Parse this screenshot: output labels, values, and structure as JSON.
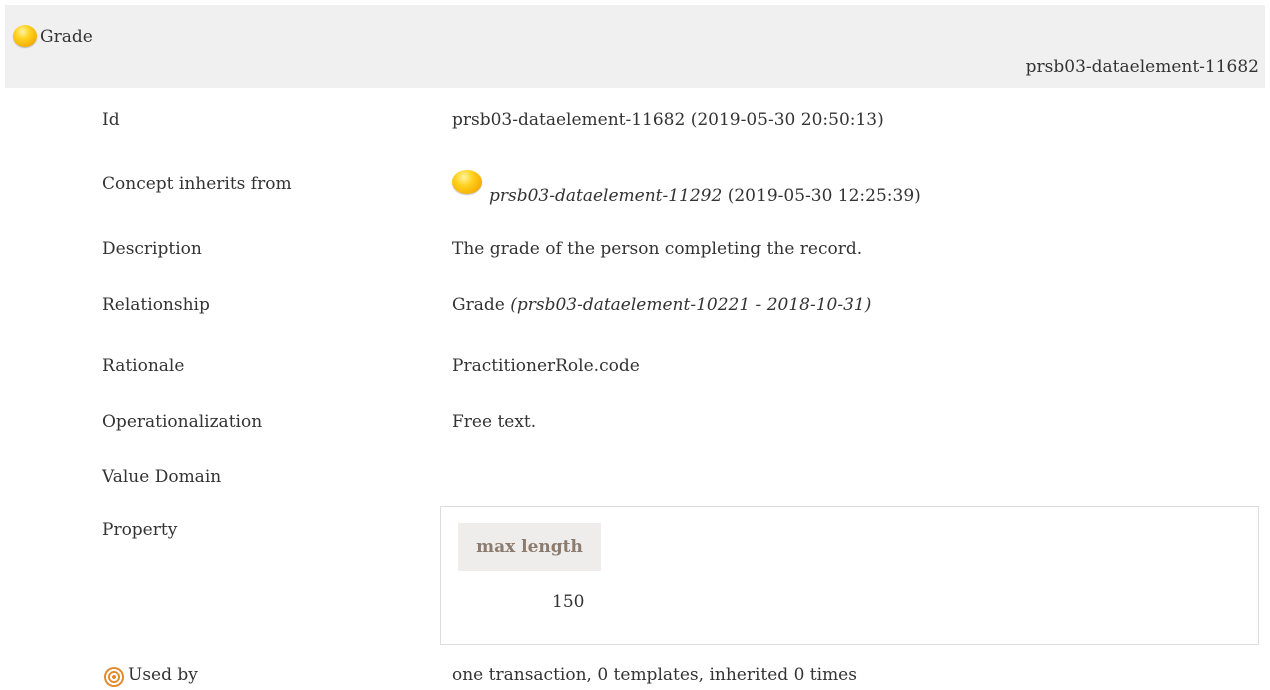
{
  "header": {
    "title": "Grade",
    "id_tag": "prsb03-dataelement-11682"
  },
  "rows": {
    "id": {
      "label": "Id",
      "value": "prsb03-dataelement-11682 (2019-05-30 20:50:13)"
    },
    "inherits": {
      "label": "Concept inherits from",
      "ref": "prsb03-dataelement-11292",
      "date": "(2019-05-30 12:25:39)"
    },
    "description": {
      "label": "Description",
      "value": "The grade of the person completing the record."
    },
    "relationship": {
      "label": "Relationship",
      "value": "Grade",
      "ref": "(prsb03-dataelement-10221 - 2018-10-31)"
    },
    "rationale": {
      "label": "Rationale",
      "value": "PractitionerRole.code"
    },
    "operationalization": {
      "label": "Operationalization",
      "value": "Free text."
    },
    "value_domain": {
      "label": "Value Domain"
    },
    "property": {
      "label": "Property",
      "column_header": "max length",
      "value": "150"
    },
    "used_by": {
      "label": "Used by",
      "value": "one transaction, 0 templates, inherited 0 times"
    }
  },
  "icons": {
    "concept": "yellow-orb-icon",
    "used_by": "target-icon"
  },
  "colors": {
    "header_bg": "#f0f0f0",
    "orb": "#ffc400",
    "property_header_text": "#8c7b6f",
    "used_by_icon": "#e38a2c"
  }
}
